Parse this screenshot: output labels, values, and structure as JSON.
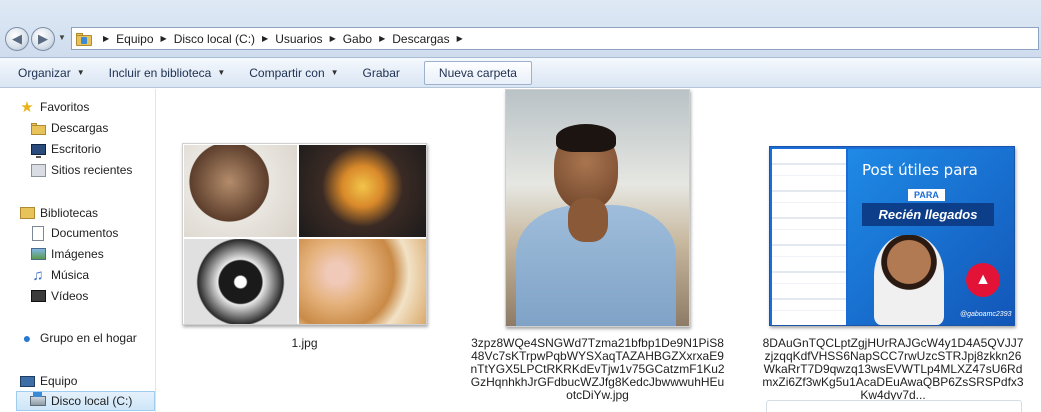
{
  "window": {
    "breadcrumb": [
      "Equipo",
      "Disco local (C:)",
      "Usuarios",
      "Gabo",
      "Descargas"
    ]
  },
  "toolbar": {
    "organize": "Organizar",
    "include_library": "Incluir en biblioteca",
    "share": "Compartir con",
    "burn": "Grabar",
    "new_folder": "Nueva carpeta"
  },
  "sidebar": {
    "favorites": {
      "label": "Favoritos",
      "items": [
        "Descargas",
        "Escritorio",
        "Sitios recientes"
      ]
    },
    "libraries": {
      "label": "Bibliotecas",
      "items": [
        "Documentos",
        "Imágenes",
        "Música",
        "Vídeos"
      ]
    },
    "homegroup": "Grupo en el hogar",
    "computer": {
      "label": "Equipo",
      "items": [
        "Disco local (C:)"
      ]
    }
  },
  "files": [
    {
      "name": "1.jpg"
    },
    {
      "name": "3zpz8WQe4SNGWd7Tzma21bfbp1De9N1PiS848Vc7sKTrpwPqbWYSXaqTAZAHBGZXxrxaE9nTtYGX5LPCtRKRKdEvTjw1v75GCatzmF1Ku2GzHqnhkhJrGFdbucWZJfg8KedcJbwwwuhHEuotcDiYw.jpg"
    },
    {
      "name": "8DAuGnTQCLptZgjHUrRAJGcW4y1D4A5QVJJ7zjzqqKdfVHSS6NapSCC7rwUzcSTRJpj8zkkn26WkaRrT7D9qwzq13wsEVWTLp4MLXZ47sU6RdmxZi6Zf3wKg5u1AcaDEuAwaQBP6ZsSRSPdfx3Kw4dyv7d..."
    }
  ],
  "post_image": {
    "title": "Post útiles para",
    "tag": "PARA",
    "subtitle": "Recién llegados",
    "handle": "@gaboamc2393"
  },
  "colors": {
    "accent": "#1a6dd6",
    "selection": "#cde6f8"
  }
}
